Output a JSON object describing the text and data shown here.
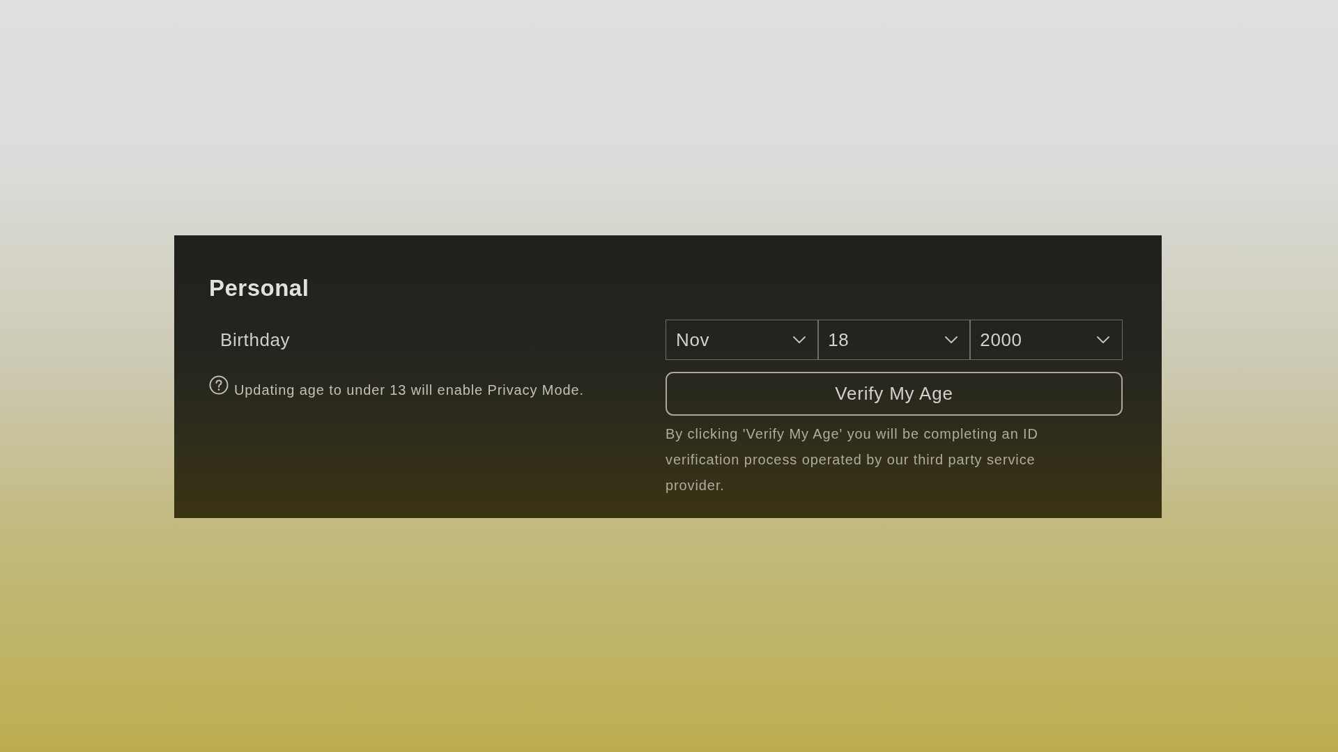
{
  "section": {
    "title": "Personal"
  },
  "birthday": {
    "label": "Birthday",
    "hint": "Updating age to under 13 will enable Privacy Mode.",
    "selects": [
      {
        "value": "Nov"
      },
      {
        "value": "18"
      },
      {
        "value": "2000"
      }
    ],
    "button": "Verify My Age",
    "disclaimer": "By clicking 'Verify My Age' you will be completing an ID verification process operated by our third party service provider."
  }
}
